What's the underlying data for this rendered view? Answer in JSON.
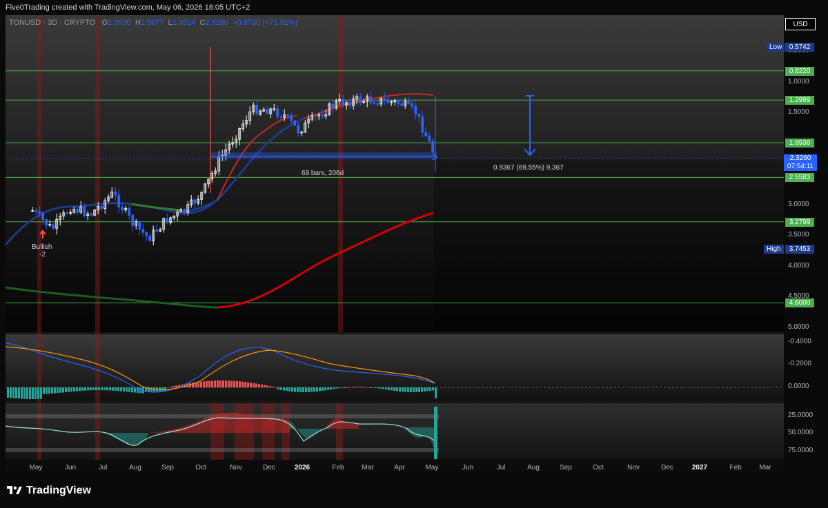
{
  "header": {
    "text": "Five0Trading created with TradingView.com, May 06, 2026 18:05 UTC+2"
  },
  "legend": {
    "symbol": "TONUSD · 3D · CRYPTO",
    "o_label": "O",
    "o": "1.3530",
    "h_label": "H",
    "h": "2.5677",
    "l_label": "L",
    "l": "1.3524",
    "c_label": "C",
    "c": "2.3260",
    "change": "+0.9730 (+71.91%)"
  },
  "currency_button": "USD",
  "price_axis": {
    "ticks": [
      "0.5000",
      "1.0000",
      "1.5000",
      "3.0000",
      "3.5000",
      "4.0000",
      "4.5000",
      "5.0000"
    ],
    "levels": [
      "0.8220",
      "1.2999",
      "1.9936",
      "2.5583",
      "3.2799",
      "4.6000"
    ],
    "low_label": "Low",
    "low_value": "0.5742",
    "high_label": "High",
    "high_value": "3.7453",
    "current_price": "2.3260",
    "countdown": "07:54:11"
  },
  "macd_axis": [
    "-0.4000",
    "-0.2000",
    "0.0000"
  ],
  "rsi_axis": [
    "25.0000",
    "50.0000",
    "75.0000"
  ],
  "time_axis": [
    "May",
    "Jun",
    "Jul",
    "Aug",
    "Sep",
    "Oct",
    "Nov",
    "Dec",
    "2026",
    "Feb",
    "Mar",
    "Apr",
    "May",
    "Jun",
    "Jul",
    "Aug",
    "Sep",
    "Oct",
    "Nov",
    "Dec",
    "2027",
    "Feb",
    "Mar"
  ],
  "annotations": {
    "bars_range": "69 bars, 206d",
    "measure": "0.9367 (69.55%) 9,367",
    "signal_top": "Bullish",
    "signal_bottom": "-2"
  },
  "brand": "TradingView",
  "colors": {
    "up": "#ffffff",
    "down": "#2962ff",
    "level": "#4caf50",
    "ema_fast": "#c62828",
    "ema_slow_green": "#1b5e20",
    "ema_slow_red": "#d50000",
    "accent": "#2962ff"
  },
  "chart_data": {
    "type": "candlestick",
    "title": "TONUSD · 3D · CRYPTO",
    "y_scale": "inverted",
    "ylim": [
      0.5,
      5.0
    ],
    "close_path": [
      {
        "date": "2025-04-27",
        "close": 3.1
      },
      {
        "date": "2025-05-15",
        "close": 3.4
      },
      {
        "date": "2025-06-01",
        "close": 3.05
      },
      {
        "date": "2025-06-20",
        "close": 3.15
      },
      {
        "date": "2025-07-10",
        "close": 2.82
      },
      {
        "date": "2025-07-28",
        "close": 3.3
      },
      {
        "date": "2025-08-12",
        "close": 3.55
      },
      {
        "date": "2025-08-28",
        "close": 3.25
      },
      {
        "date": "2025-09-15",
        "close": 3.1
      },
      {
        "date": "2025-10-01",
        "close": 2.8
      },
      {
        "date": "2025-10-15",
        "close": 2.3
      },
      {
        "date": "2025-11-01",
        "close": 1.85
      },
      {
        "date": "2025-11-15",
        "close": 1.45
      },
      {
        "date": "2025-12-01",
        "close": 1.45
      },
      {
        "date": "2025-12-15",
        "close": 1.55
      },
      {
        "date": "2025-12-28",
        "close": 1.8
      },
      {
        "date": "2026-01-15",
        "close": 1.55
      },
      {
        "date": "2026-02-01",
        "close": 1.35
      },
      {
        "date": "2026-02-20",
        "close": 1.3
      },
      {
        "date": "2026-03-10",
        "close": 1.3
      },
      {
        "date": "2026-04-01",
        "close": 1.35
      },
      {
        "date": "2026-04-15",
        "close": 1.5
      },
      {
        "date": "2026-05-06",
        "close": 2.326
      }
    ],
    "horizontal_levels": [
      0.822,
      1.2999,
      1.9936,
      2.5583,
      3.2799,
      4.6
    ],
    "measure": {
      "bars": 69,
      "days": 206,
      "change": 0.9367,
      "change_pct": 69.55
    },
    "macd": {
      "ylim": [
        -0.45,
        0.05
      ]
    },
    "rsi": {
      "ylim": [
        15,
        80
      ]
    }
  }
}
